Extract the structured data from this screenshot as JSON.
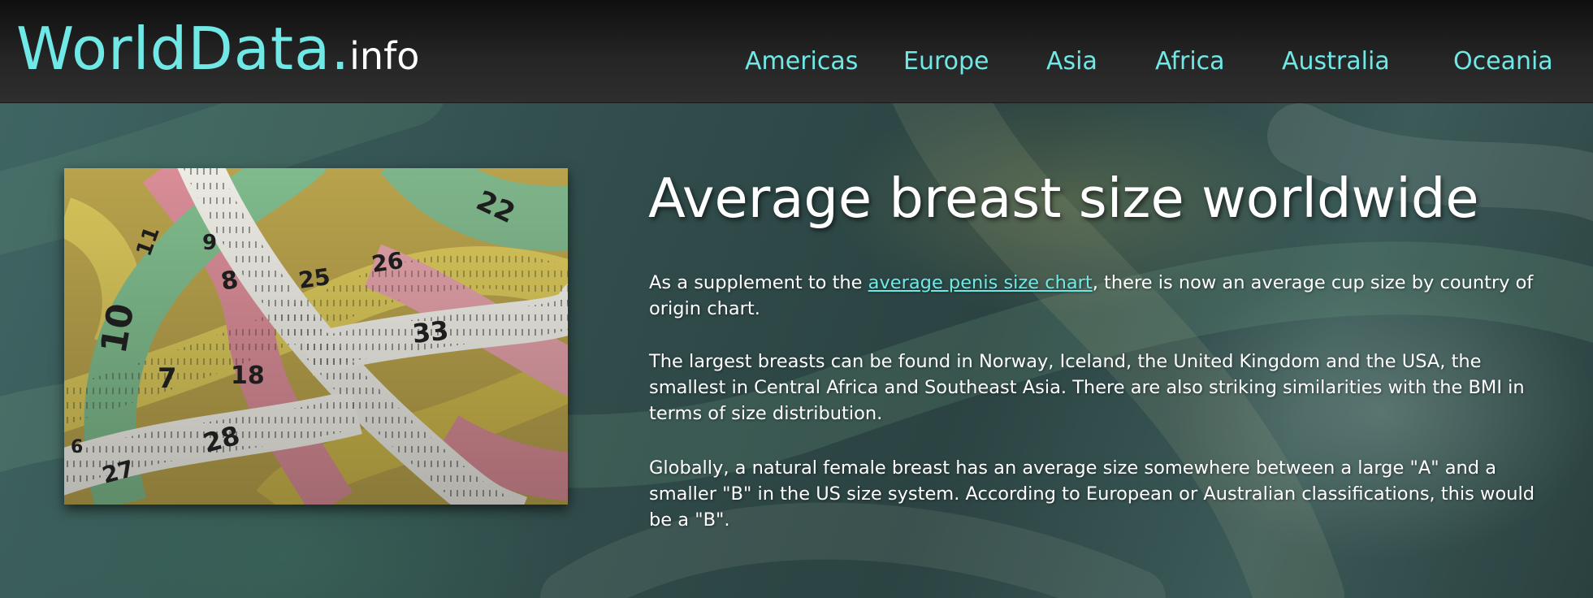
{
  "header": {
    "logo": {
      "main": "WorldData",
      "dot": ".",
      "suffix": "info"
    },
    "nav": [
      {
        "label": "Americas"
      },
      {
        "label": "Europe"
      },
      {
        "label": "Asia"
      },
      {
        "label": "Africa"
      },
      {
        "label": "Australia"
      },
      {
        "label": "Oceania"
      }
    ]
  },
  "main": {
    "title": "Average breast size worldwide",
    "paragraphs": [
      {
        "before": "As a supplement to the ",
        "link": "average penis size chart",
        "after": ", there is now an average cup size by country of origin chart."
      },
      {
        "text": "The largest breasts can be found in Norway, Iceland, the United Kingdom and the USA, the smallest in Central Africa and Southeast Asia. There are also striking similarities with the BMI in terms of size distribution."
      },
      {
        "text": "Globally, a natural female breast has an average size somewhere between a large \"A\" and a smaller \"B\" in the US size system. According to European or Australian classifications, this would be a \"B\"."
      }
    ],
    "image": {
      "subject": "tangled measuring tapes",
      "tape_numbers": [
        "22",
        "11",
        "9",
        "8",
        "25",
        "26",
        "10",
        "7",
        "33",
        "18",
        "28",
        "27",
        "6"
      ]
    }
  },
  "colors": {
    "accent": "#6fe8e6",
    "header_bg": "#1f1f1f",
    "text": "#ffffff"
  }
}
